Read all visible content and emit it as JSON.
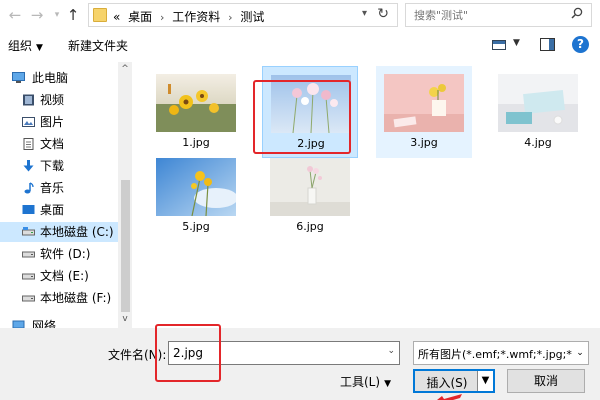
{
  "address": {
    "prefix": "«",
    "crumbs": [
      "桌面",
      "工作资料",
      "测试"
    ],
    "separator": "›"
  },
  "search": {
    "placeholder": "搜索\"测试\""
  },
  "toolbar": {
    "organize_label": "组织",
    "new_folder_label": "新建文件夹",
    "help_label": "?"
  },
  "nav": {
    "items": [
      {
        "label": "此电脑",
        "icon": "computer-icon"
      },
      {
        "label": "视频",
        "icon": "video-icon"
      },
      {
        "label": "图片",
        "icon": "pictures-icon"
      },
      {
        "label": "文档",
        "icon": "documents-icon"
      },
      {
        "label": "下载",
        "icon": "download-icon"
      },
      {
        "label": "音乐",
        "icon": "music-icon"
      },
      {
        "label": "桌面",
        "icon": "desktop-icon"
      },
      {
        "label": "本地磁盘 (C:)",
        "icon": "drive-icon"
      },
      {
        "label": "软件 (D:)",
        "icon": "drive-icon"
      },
      {
        "label": "文档 (E:)",
        "icon": "drive-icon"
      },
      {
        "label": "本地磁盘 (F:)",
        "icon": "drive-icon"
      },
      {
        "label": "网络",
        "icon": "network-icon"
      }
    ]
  },
  "files": [
    {
      "name": "1.jpg"
    },
    {
      "name": "2.jpg"
    },
    {
      "name": "3.jpg"
    },
    {
      "name": "4.jpg"
    },
    {
      "name": "5.jpg"
    },
    {
      "name": "6.jpg"
    }
  ],
  "footer": {
    "filename_label": "文件名(N):",
    "filename_value": "2.jpg",
    "filter_value": "所有图片(*.emf;*.wmf;*.jpg;*.jpeg",
    "tools_label": "工具(L)",
    "insert_label": "插入(S)",
    "cancel_label": "取消"
  },
  "colors": {
    "selection": "#cce8ff",
    "highlight_box": "#e3262a",
    "accent": "#0078d7"
  }
}
